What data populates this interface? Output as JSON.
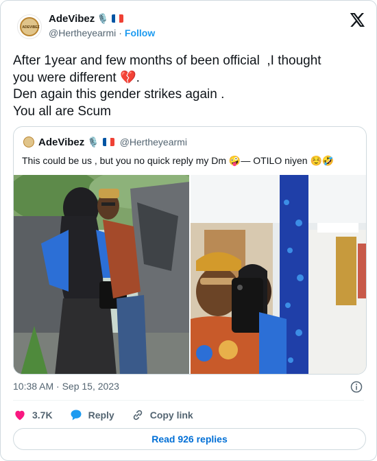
{
  "author": {
    "display_name": "AdeVibez",
    "name_emoji": "🎙️",
    "handle": "@Hertheyearmi",
    "separator": "·",
    "follow_label": "Follow",
    "avatar_text": "ADEVIBEZ"
  },
  "tweet": {
    "lines": [
      "After 1year and few months of been official  ,I thought",
      "you were different 💔.",
      "Den again this gender strikes again .",
      "You all are Scum"
    ]
  },
  "quote": {
    "display_name": "AdeVibez",
    "name_emoji": "🎙️",
    "handle": "@Hertheyearmi",
    "text": "This could be us , but you no quick reply my Dm 🤪— OTILO niyen ☺️🤣"
  },
  "meta": {
    "timestamp": "10:38 AM · Sep 15, 2023"
  },
  "actions": {
    "like_count": "3.7K",
    "reply_label": "Reply",
    "copy_link_label": "Copy link"
  },
  "footer": {
    "read_replies_label": "Read 926 replies"
  },
  "colors": {
    "accent": "#1d9bf0",
    "heart": "#f91880",
    "reply_blue": "#1d9bf0",
    "secondary_text": "#536471",
    "border": "#cfd9de"
  },
  "icons": {
    "platform_logo": "x-logo-icon",
    "like": "heart-icon",
    "reply": "reply-bubble-icon",
    "copy_link": "link-icon",
    "info": "info-icon",
    "flag": "france-flag-icon"
  }
}
